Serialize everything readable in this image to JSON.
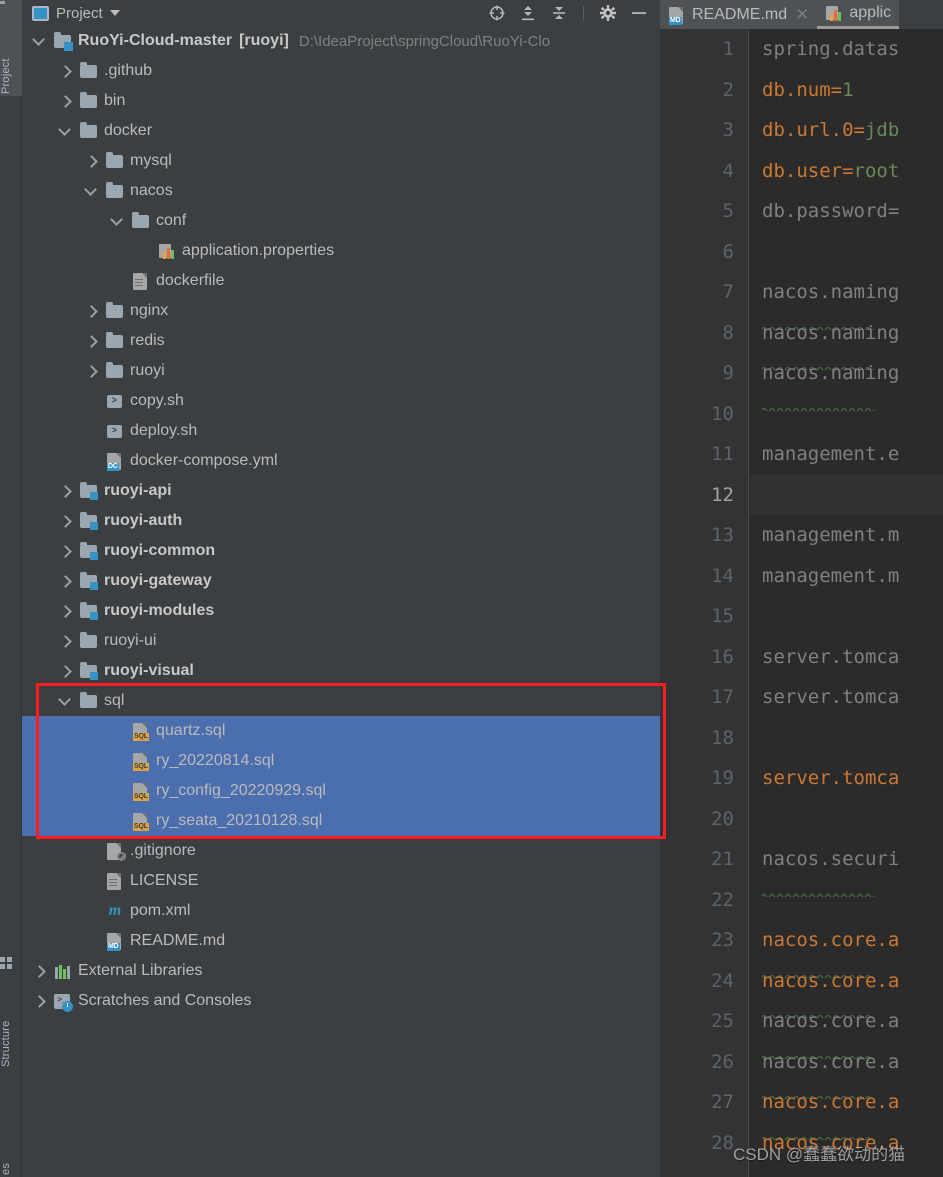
{
  "stripe": {
    "buttons": [
      {
        "label": "Project",
        "icon": "folder-icon",
        "active": true
      },
      {
        "label": "Structure",
        "icon": "structure-icon",
        "active": false
      },
      {
        "label": "es",
        "icon": "",
        "active": false
      }
    ]
  },
  "panel": {
    "title": "Project",
    "icon": "project-view-icon",
    "dropdown_icon": "chevron-down-icon",
    "tools": [
      {
        "name": "locate-icon",
        "title": "Select Opened File"
      },
      {
        "name": "expand-all-icon",
        "title": "Expand All"
      },
      {
        "name": "collapse-all-icon",
        "title": "Collapse All"
      },
      {
        "name": "settings-gear-icon",
        "title": "Settings"
      },
      {
        "name": "minimize-icon",
        "title": "Hide"
      }
    ]
  },
  "tree": [
    {
      "indent": 0,
      "arrow": "down",
      "icon": "project-folder-icon",
      "label": "RuoYi-Cloud-master",
      "suffix": "[ruoyi]",
      "bold": true,
      "path": "D:\\IdeaProject\\springCloud\\RuoYi-Clo",
      "selected": false
    },
    {
      "indent": 1,
      "arrow": "right",
      "icon": "folder-icon",
      "label": ".github",
      "bold": false,
      "selected": false
    },
    {
      "indent": 1,
      "arrow": "right",
      "icon": "folder-icon",
      "label": "bin",
      "bold": false,
      "selected": false
    },
    {
      "indent": 1,
      "arrow": "down",
      "icon": "folder-icon",
      "label": "docker",
      "bold": false,
      "selected": false
    },
    {
      "indent": 2,
      "arrow": "right",
      "icon": "folder-icon",
      "label": "mysql",
      "bold": false,
      "selected": false
    },
    {
      "indent": 2,
      "arrow": "down",
      "icon": "folder-icon",
      "label": "nacos",
      "bold": false,
      "selected": false
    },
    {
      "indent": 3,
      "arrow": "down",
      "icon": "folder-icon",
      "label": "conf",
      "bold": false,
      "selected": false
    },
    {
      "indent": 4,
      "arrow": "none",
      "icon": "properties-file-icon",
      "label": "application.properties",
      "bold": false,
      "selected": false
    },
    {
      "indent": 3,
      "arrow": "none",
      "icon": "text-file-icon",
      "label": "dockerfile",
      "bold": false,
      "selected": false
    },
    {
      "indent": 2,
      "arrow": "right",
      "icon": "folder-icon",
      "label": "nginx",
      "bold": false,
      "selected": false
    },
    {
      "indent": 2,
      "arrow": "right",
      "icon": "folder-icon",
      "label": "redis",
      "bold": false,
      "selected": false
    },
    {
      "indent": 2,
      "arrow": "right",
      "icon": "folder-icon",
      "label": "ruoyi",
      "bold": false,
      "selected": false
    },
    {
      "indent": 2,
      "arrow": "none",
      "icon": "shell-script-icon",
      "label": "copy.sh",
      "bold": false,
      "selected": false
    },
    {
      "indent": 2,
      "arrow": "none",
      "icon": "shell-script-icon",
      "label": "deploy.sh",
      "bold": false,
      "selected": false
    },
    {
      "indent": 2,
      "arrow": "none",
      "icon": "docker-compose-icon",
      "label": "docker-compose.yml",
      "bold": false,
      "selected": false
    },
    {
      "indent": 1,
      "arrow": "right",
      "icon": "module-folder-icon",
      "label": "ruoyi-api",
      "bold": true,
      "selected": false
    },
    {
      "indent": 1,
      "arrow": "right",
      "icon": "module-folder-icon",
      "label": "ruoyi-auth",
      "bold": true,
      "selected": false
    },
    {
      "indent": 1,
      "arrow": "right",
      "icon": "module-folder-icon",
      "label": "ruoyi-common",
      "bold": true,
      "selected": false
    },
    {
      "indent": 1,
      "arrow": "right",
      "icon": "module-folder-icon",
      "label": "ruoyi-gateway",
      "bold": true,
      "selected": false
    },
    {
      "indent": 1,
      "arrow": "right",
      "icon": "module-folder-icon",
      "label": "ruoyi-modules",
      "bold": true,
      "selected": false
    },
    {
      "indent": 1,
      "arrow": "right",
      "icon": "folder-icon",
      "label": "ruoyi-ui",
      "bold": false,
      "selected": false
    },
    {
      "indent": 1,
      "arrow": "right",
      "icon": "module-folder-icon",
      "label": "ruoyi-visual",
      "bold": true,
      "selected": false
    },
    {
      "indent": 1,
      "arrow": "down",
      "icon": "folder-icon",
      "label": "sql",
      "bold": false,
      "selected": false
    },
    {
      "indent": 3,
      "arrow": "none",
      "icon": "sql-file-icon",
      "label": "quartz.sql",
      "bold": false,
      "selected": true
    },
    {
      "indent": 3,
      "arrow": "none",
      "icon": "sql-file-icon",
      "label": "ry_20220814.sql",
      "bold": false,
      "selected": true
    },
    {
      "indent": 3,
      "arrow": "none",
      "icon": "sql-file-icon",
      "label": "ry_config_20220929.sql",
      "bold": false,
      "selected": true
    },
    {
      "indent": 3,
      "arrow": "none",
      "icon": "sql-file-icon",
      "label": "ry_seata_20210128.sql",
      "bold": false,
      "selected": true
    },
    {
      "indent": 2,
      "arrow": "none",
      "icon": "gitignore-file-icon",
      "label": ".gitignore",
      "bold": false,
      "selected": false
    },
    {
      "indent": 2,
      "arrow": "none",
      "icon": "text-file-icon",
      "label": "LICENSE",
      "bold": false,
      "selected": false
    },
    {
      "indent": 2,
      "arrow": "none",
      "icon": "maven-pom-icon",
      "label": "pom.xml",
      "bold": false,
      "selected": false
    },
    {
      "indent": 2,
      "arrow": "none",
      "icon": "markdown-file-icon",
      "label": "README.md",
      "bold": false,
      "selected": false
    },
    {
      "indent": 0,
      "arrow": "right",
      "icon": "external-libraries-icon",
      "label": "External Libraries",
      "bold": false,
      "selected": false
    },
    {
      "indent": 0,
      "arrow": "right",
      "icon": "scratches-icon",
      "label": "Scratches and Consoles",
      "bold": false,
      "selected": false
    }
  ],
  "editor": {
    "tabs": [
      {
        "label": "README.md",
        "icon": "markdown-file-icon",
        "active": false,
        "closable": true
      },
      {
        "label": "applic",
        "icon": "properties-file-icon",
        "active": true,
        "closable": false
      }
    ],
    "current_line": 12,
    "lines": [
      {
        "n": 1,
        "segments": [
          {
            "t": "spring.datas",
            "c": "dim"
          }
        ],
        "squiggle": false
      },
      {
        "n": 2,
        "segments": [
          {
            "t": "db.num",
            "c": "key"
          },
          {
            "t": "=",
            "c": "plain"
          },
          {
            "t": "1",
            "c": "num"
          }
        ],
        "squiggle": false
      },
      {
        "n": 3,
        "segments": [
          {
            "t": "db.url.0",
            "c": "key"
          },
          {
            "t": "=",
            "c": "plain"
          },
          {
            "t": "jdb",
            "c": "val"
          }
        ],
        "squiggle": false
      },
      {
        "n": 4,
        "segments": [
          {
            "t": "db.user",
            "c": "key"
          },
          {
            "t": "=",
            "c": "plain"
          },
          {
            "t": "root",
            "c": "val"
          }
        ],
        "squiggle": false
      },
      {
        "n": 5,
        "segments": [
          {
            "t": "db.password=",
            "c": "dim"
          }
        ],
        "squiggle": false
      },
      {
        "n": 6,
        "segments": [],
        "squiggle": false
      },
      {
        "n": 7,
        "segments": [
          {
            "t": "nacos.naming",
            "c": "dim"
          }
        ],
        "squiggle": true
      },
      {
        "n": 8,
        "segments": [
          {
            "t": "nacos.naming",
            "c": "dim"
          }
        ],
        "squiggle": true
      },
      {
        "n": 9,
        "segments": [
          {
            "t": "nacos.naming",
            "c": "dim"
          }
        ],
        "squiggle": true
      },
      {
        "n": 10,
        "segments": [],
        "squiggle": false
      },
      {
        "n": 11,
        "segments": [
          {
            "t": "management.e",
            "c": "dim"
          }
        ],
        "squiggle": false
      },
      {
        "n": 12,
        "segments": [],
        "squiggle": false
      },
      {
        "n": 13,
        "segments": [
          {
            "t": "management.m",
            "c": "dim"
          }
        ],
        "squiggle": false
      },
      {
        "n": 14,
        "segments": [
          {
            "t": "management.m",
            "c": "dim"
          }
        ],
        "squiggle": false
      },
      {
        "n": 15,
        "segments": [],
        "squiggle": false
      },
      {
        "n": 16,
        "segments": [
          {
            "t": "server.tomca",
            "c": "dim"
          }
        ],
        "squiggle": false
      },
      {
        "n": 17,
        "segments": [
          {
            "t": "server.tomca",
            "c": "dim"
          }
        ],
        "squiggle": false
      },
      {
        "n": 18,
        "segments": [],
        "squiggle": false
      },
      {
        "n": 19,
        "segments": [
          {
            "t": "server.tomca",
            "c": "key"
          }
        ],
        "squiggle": false
      },
      {
        "n": 20,
        "segments": [],
        "squiggle": false
      },
      {
        "n": 21,
        "segments": [
          {
            "t": "nacos.securi",
            "c": "dim"
          }
        ],
        "squiggle": true
      },
      {
        "n": 22,
        "segments": [],
        "squiggle": false
      },
      {
        "n": 23,
        "segments": [
          {
            "t": "nacos.core.a",
            "c": "key"
          }
        ],
        "squiggle": true
      },
      {
        "n": 24,
        "segments": [
          {
            "t": "nacos.core.a",
            "c": "key"
          }
        ],
        "squiggle": true
      },
      {
        "n": 25,
        "segments": [
          {
            "t": "nacos.core.a",
            "c": "dim"
          }
        ],
        "squiggle": true
      },
      {
        "n": 26,
        "segments": [
          {
            "t": "nacos.core.a",
            "c": "dim"
          }
        ],
        "squiggle": true
      },
      {
        "n": 27,
        "segments": [
          {
            "t": "nacos.core.a",
            "c": "key"
          }
        ],
        "squiggle": true
      },
      {
        "n": 28,
        "segments": [
          {
            "t": "nacos.core.a",
            "c": "key"
          }
        ],
        "squiggle": true
      }
    ]
  },
  "watermark": "CSDN @蠢蠢欲动的猫",
  "colors": {
    "selection_blue": "#4B6EAF",
    "annotation_red": "#FF1B22",
    "accent_blue": "#3592C4",
    "keyword_orange": "#CC7832",
    "value_green": "#6A8759",
    "panel_bg": "#3C3F41",
    "editor_bg": "#2B2B2B"
  }
}
